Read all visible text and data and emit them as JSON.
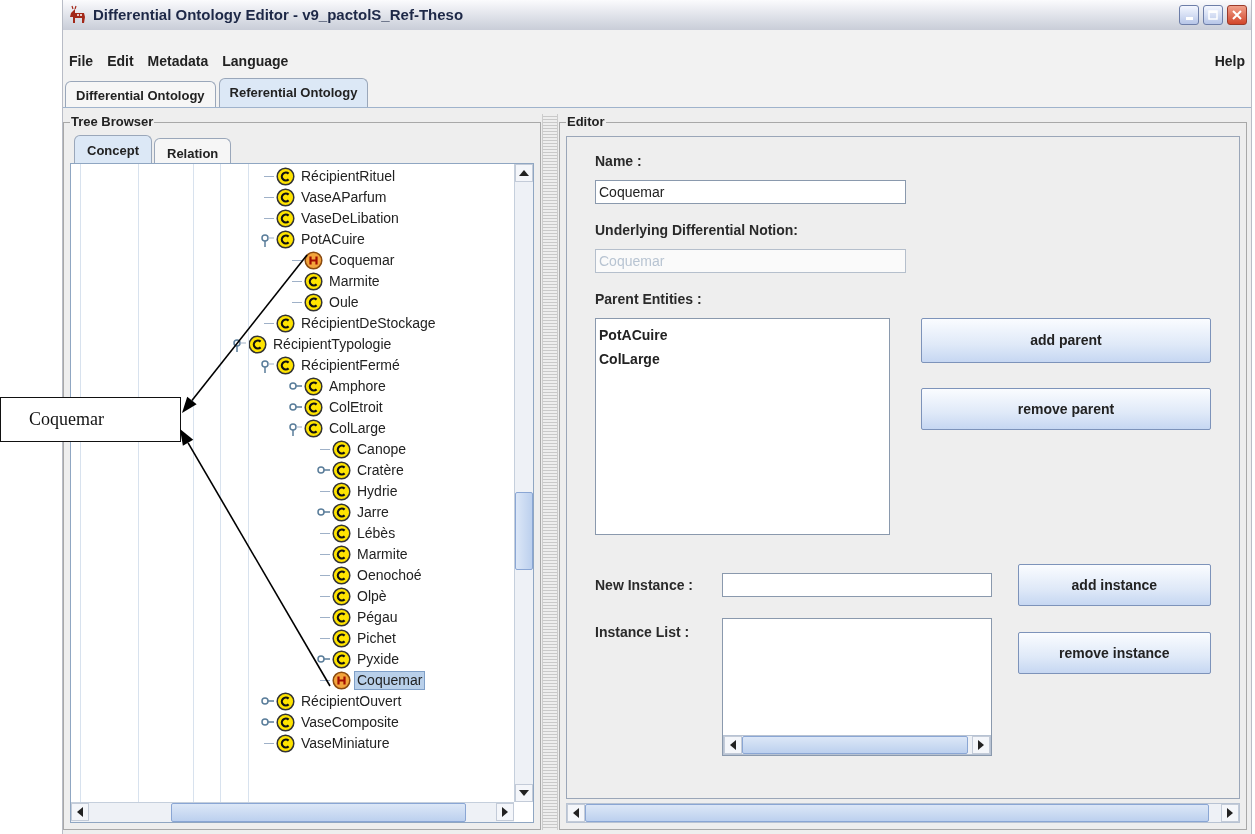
{
  "window": {
    "title": "Differential Ontology Editor - v9_pactolS_Ref-Theso"
  },
  "menu": [
    {
      "label": "File"
    },
    {
      "label": "Edit"
    },
    {
      "label": "Metadata"
    },
    {
      "label": "Language"
    }
  ],
  "help_menu": {
    "label": "Help"
  },
  "main_tabs": [
    {
      "label": "Differential Ontology",
      "selected": false
    },
    {
      "label": "Referential Ontology",
      "selected": true
    }
  ],
  "tree_browser": {
    "title": "Tree Browser",
    "tabs": [
      {
        "label": "Concept",
        "selected": true
      },
      {
        "label": "Relation",
        "selected": false
      }
    ],
    "items": [
      {
        "children": [
          {
            "label": "RécipientRituel",
            "kind": "concept",
            "selected": false
          },
          {
            "label": "VaseAParfum",
            "kind": "concept",
            "selected": false
          },
          {
            "label": "VaseDeLibation",
            "kind": "concept",
            "selected": false
          },
          {
            "label": "PotACuire",
            "kind": "concept",
            "selected": false,
            "expanded": true,
            "children": [
              {
                "label": "Coquemar",
                "kind": "instance",
                "selected": false
              },
              {
                "label": "Marmite",
                "kind": "concept",
                "selected": false
              },
              {
                "label": "Oule",
                "kind": "concept",
                "selected": false
              }
            ]
          },
          {
            "label": "RécipientDeStockage",
            "kind": "concept",
            "selected": false
          }
        ]
      },
      {
        "label": "RécipientTypologie",
        "kind": "concept",
        "selected": false,
        "expanded": true,
        "children": [
          {
            "label": "RécipientFermé",
            "kind": "concept",
            "selected": false,
            "expanded": true,
            "children": [
              {
                "label": "Amphore",
                "kind": "concept",
                "selected": false,
                "expanded": false
              },
              {
                "label": "ColEtroit",
                "kind": "concept",
                "selected": false,
                "expanded": false
              },
              {
                "label": "ColLarge",
                "kind": "concept",
                "selected": false,
                "expanded": true,
                "children": [
                  {
                    "label": "Canope",
                    "kind": "concept",
                    "selected": false
                  },
                  {
                    "label": "Cratère",
                    "kind": "concept",
                    "selected": false,
                    "expanded": false
                  },
                  {
                    "label": "Hydrie",
                    "kind": "concept",
                    "selected": false
                  },
                  {
                    "label": "Jarre",
                    "kind": "concept",
                    "selected": false,
                    "expanded": false
                  },
                  {
                    "label": "Lébès",
                    "kind": "concept",
                    "selected": false
                  },
                  {
                    "label": "Marmite",
                    "kind": "concept",
                    "selected": false
                  },
                  {
                    "label": "Oenochoé",
                    "kind": "concept",
                    "selected": false
                  },
                  {
                    "label": "Olpè",
                    "kind": "concept",
                    "selected": false
                  },
                  {
                    "label": "Pégau",
                    "kind": "concept",
                    "selected": false
                  },
                  {
                    "label": "Pichet",
                    "kind": "concept",
                    "selected": false
                  },
                  {
                    "label": "Pyxide",
                    "kind": "concept",
                    "selected": false,
                    "expanded": false
                  },
                  {
                    "label": "Coquemar",
                    "kind": "instance",
                    "selected": true
                  }
                ]
              }
            ]
          },
          {
            "label": "RécipientOuvert",
            "kind": "concept",
            "selected": false,
            "expanded": false
          },
          {
            "label": "VaseComposite",
            "kind": "concept",
            "selected": false,
            "expanded": false
          },
          {
            "label": "VaseMiniature",
            "kind": "concept",
            "selected": false
          }
        ]
      }
    ]
  },
  "editor": {
    "title": "Editor",
    "name_label": "Name :",
    "name_value": "Coquemar",
    "notion_label": "Underlying Differential Notion:",
    "notion_value": "Coquemar",
    "notion_disabled": true,
    "parents_label": "Parent Entities :",
    "parents": [
      "PotACuire",
      "ColLarge"
    ],
    "add_parent": "add parent",
    "remove_parent": "remove parent",
    "new_instance_label": "New Instance :",
    "add_instance": "add instance",
    "instance_list_label": "Instance List :",
    "remove_instance": "remove instance"
  },
  "annotation": {
    "label": "Coquemar"
  }
}
